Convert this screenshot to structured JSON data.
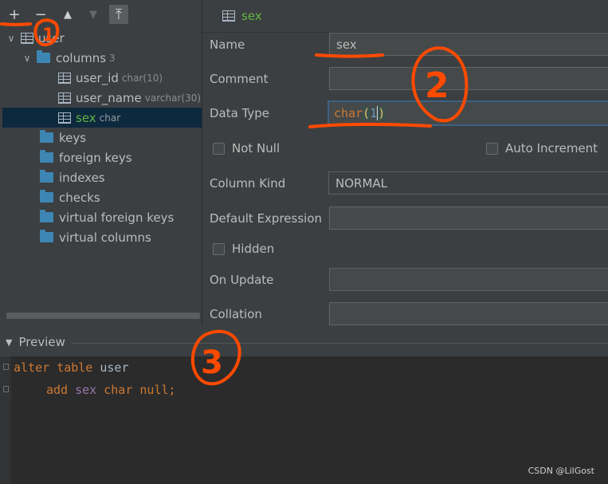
{
  "toolbar": {
    "buttons": [
      {
        "name": "add-icon",
        "glyph": "+"
      },
      {
        "name": "remove-icon",
        "glyph": "−"
      },
      {
        "name": "move-up-icon",
        "glyph": "▲"
      },
      {
        "name": "move-down-icon",
        "glyph": "▼"
      },
      {
        "name": "move-top-icon",
        "glyph": "⤒"
      }
    ]
  },
  "tree": {
    "table": "user",
    "columns_label": "columns",
    "columns_count": "3",
    "columns": [
      {
        "name": "user_id",
        "type": "char(10)"
      },
      {
        "name": "user_name",
        "type": "varchar(30)"
      },
      {
        "name": "sex",
        "type": "char"
      }
    ],
    "folders": [
      "keys",
      "foreign keys",
      "indexes",
      "checks",
      "virtual foreign keys",
      "virtual columns"
    ]
  },
  "editor": {
    "tab_title": "sex",
    "name_label": "Name",
    "name_value": "sex",
    "comment_label": "Comment",
    "comment_value": "",
    "datatype_label": "Data Type",
    "datatype_kw": "char",
    "datatype_open": "(",
    "datatype_num": "1",
    "datatype_close": ")",
    "notnull_label": "Not Null",
    "autoinc_label": "Auto Increment",
    "kind_label": "Column Kind",
    "kind_value": "NORMAL",
    "default_label": "Default Expression",
    "default_value": "",
    "hidden_label": "Hidden",
    "onupdate_label": "On Update",
    "collation_label": "Collation"
  },
  "preview": {
    "title": "Preview",
    "line1_kw1": "alter",
    "line1_kw2": "table",
    "line1_ident": "user",
    "line2_kw1": "add",
    "line2_ident": "sex",
    "line2_kw2": "char",
    "line2_kw3": "null;"
  },
  "annotations": [
    "1",
    "2",
    "3"
  ],
  "watermark": "CSDN @LilGost",
  "colors": {
    "annotation": "#ff4a00",
    "keyword": "#cc7832",
    "identifier": "#9876aa",
    "accent_green": "#62b543"
  }
}
